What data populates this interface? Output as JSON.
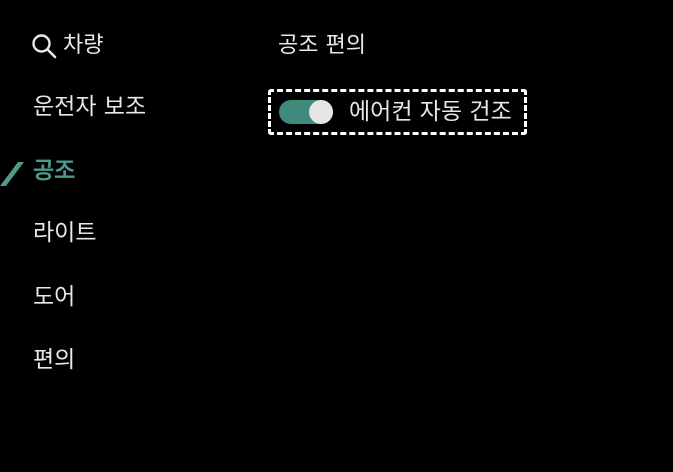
{
  "sidebar": {
    "search": {
      "icon": "search-icon",
      "label": "차량"
    },
    "items": [
      {
        "label": "운전자 보조",
        "active": false
      },
      {
        "label": "공조",
        "active": true
      },
      {
        "label": "라이트",
        "active": false
      },
      {
        "label": "도어",
        "active": false
      },
      {
        "label": "편의",
        "active": false
      }
    ],
    "active_marker_icon": "active-checkmark-icon"
  },
  "main": {
    "section_title": "공조 편의",
    "settings": [
      {
        "label": "에어컨 자동 건조",
        "enabled": true,
        "focused": true
      }
    ]
  },
  "colors": {
    "background": "#000000",
    "text": "#e8e8e8",
    "accent": "#4d9a8c",
    "toggle_on": "#3f8a7a",
    "toggle_knob": "#e6e6e6",
    "focus_outline": "#ffffff"
  }
}
